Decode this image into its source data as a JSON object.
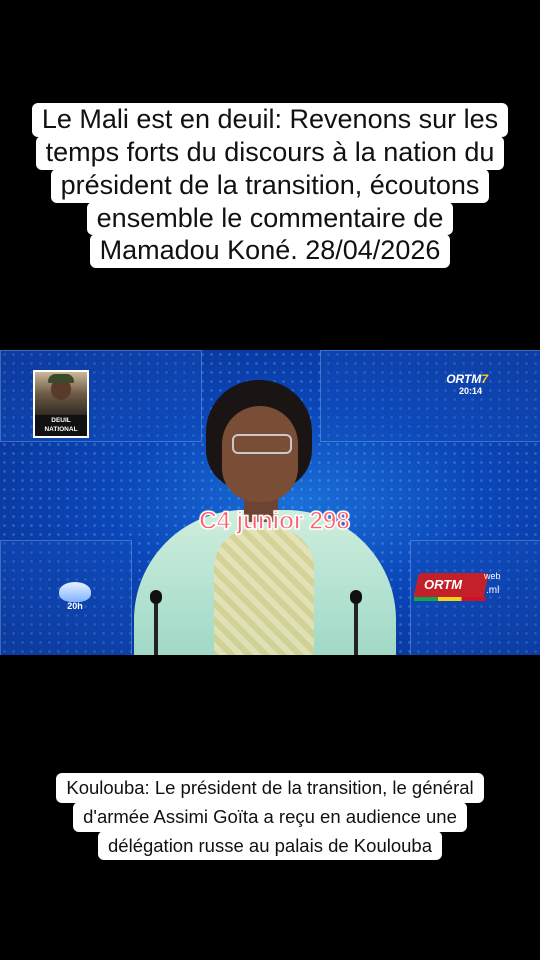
{
  "captions": {
    "top_lines": [
      "Le Mali est en deuil: Revenons sur les",
      "temps forts du discours à la nation du",
      "président de la transition, écoutons",
      "ensemble le commentaire de",
      "Mamadou Koné. 28/04/2026"
    ],
    "bottom_lines": [
      "Koulouba: Le président de la transition, le général",
      "d'armée Assimi Goïta a reçu en audience une",
      "délégation russe au palais de Koulouba"
    ]
  },
  "video": {
    "deuil_label_line1": "DEUIL",
    "deuil_label_line2": "NATIONAL",
    "channel_logo_main": "ORTM",
    "channel_logo_number": "7",
    "clock": "20:14",
    "news_logo_label": "20h",
    "web_badge_word": "ORTM",
    "web_badge_web": "web",
    "web_badge_tld": ".ml",
    "watermark": "C4 junior 298"
  },
  "colors": {
    "background": "#000000",
    "studio_blue": "#0b46b8",
    "watermark_pink": "#ff5e6c",
    "badge_red": "#c4202a"
  }
}
